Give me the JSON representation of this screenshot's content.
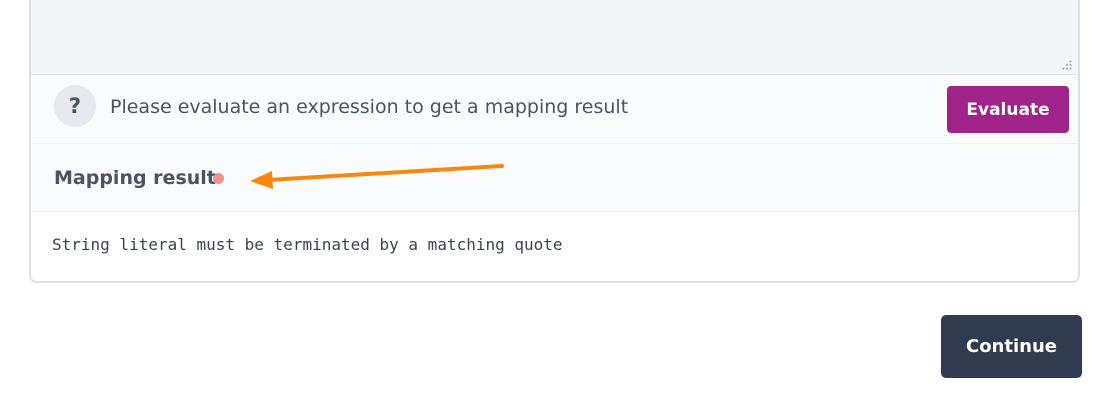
{
  "status": {
    "help_icon": "?",
    "message": "Please evaluate an expression to get a mapping result"
  },
  "toolbar": {
    "evaluate_label": "Evaluate"
  },
  "result": {
    "title": "Mapping result",
    "status_color": "#f0928a",
    "message": "String literal must be terminated by a matching quote"
  },
  "footer": {
    "continue_label": "Continue"
  },
  "colors": {
    "accent": "#a0238a",
    "primary": "#2f3c50",
    "annotation_arrow": "#f5880d"
  }
}
